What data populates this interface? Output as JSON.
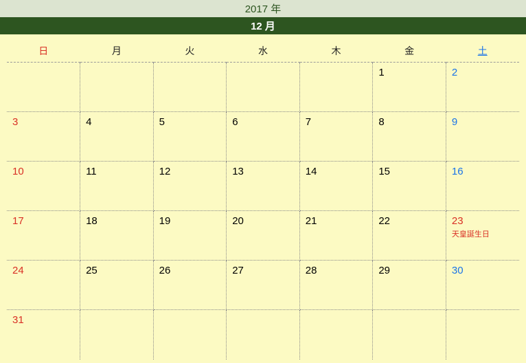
{
  "year_label": "2017 年",
  "month_label": "12 月",
  "weekdays": {
    "sun": "日",
    "mon": "月",
    "tue": "火",
    "wed": "水",
    "thu": "木",
    "fri": "金",
    "sat": "土"
  },
  "cells": {
    "r0c5": "1",
    "r0c6": "2",
    "r1c0": "3",
    "r1c1": "4",
    "r1c2": "5",
    "r1c3": "6",
    "r1c4": "7",
    "r1c5": "8",
    "r1c6": "9",
    "r2c0": "10",
    "r2c1": "11",
    "r2c2": "12",
    "r2c3": "13",
    "r2c4": "14",
    "r2c5": "15",
    "r2c6": "16",
    "r3c0": "17",
    "r3c1": "18",
    "r3c2": "19",
    "r3c3": "20",
    "r3c4": "21",
    "r3c5": "22",
    "r3c6": "23",
    "r4c0": "24",
    "r4c1": "25",
    "r4c2": "26",
    "r4c3": "27",
    "r4c4": "28",
    "r4c5": "29",
    "r4c6": "30",
    "r5c0": "31"
  },
  "holidays": {
    "r3c6": "天皇誕生日"
  },
  "chart_data": {
    "type": "table",
    "title": "2017年12月 カレンダー",
    "columns": [
      "日",
      "月",
      "火",
      "水",
      "木",
      "金",
      "土"
    ],
    "rows": [
      [
        "",
        "",
        "",
        "",
        "",
        "1",
        "2"
      ],
      [
        "3",
        "4",
        "5",
        "6",
        "7",
        "8",
        "9"
      ],
      [
        "10",
        "11",
        "12",
        "13",
        "14",
        "15",
        "16"
      ],
      [
        "17",
        "18",
        "19",
        "20",
        "21",
        "22",
        "23 天皇誕生日"
      ],
      [
        "24",
        "25",
        "26",
        "27",
        "28",
        "29",
        "30"
      ],
      [
        "31",
        "",
        "",
        "",
        "",
        "",
        ""
      ]
    ]
  }
}
